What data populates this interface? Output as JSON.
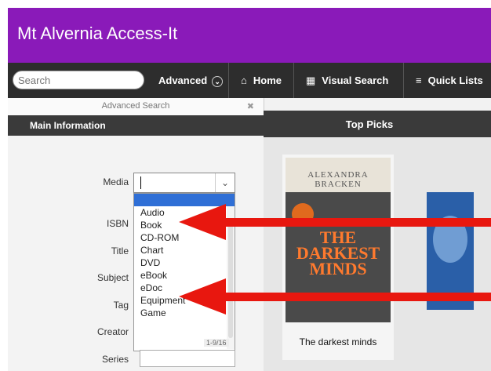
{
  "app": {
    "title": "Mt Alvernia Access-It"
  },
  "navbar": {
    "search_placeholder": "Search",
    "advanced_label": "Advanced",
    "home_label": "Home",
    "visual_search_label": "Visual Search",
    "quick_lists_label": "Quick Lists"
  },
  "advanced_search": {
    "panel_title": "Advanced Search",
    "close_glyph": "✖",
    "section_title": "Main Information",
    "labels": {
      "media": "Media",
      "isbn": "ISBN",
      "title": "Title",
      "subject": "Subject",
      "tag": "Tag",
      "creator": "Creator",
      "series": "Series"
    },
    "media_value": "",
    "media_options": [
      "Audio",
      "Book",
      "CD-ROM",
      "Chart",
      "DVD",
      "eBook",
      "eDoc",
      "Equipment",
      "Game"
    ],
    "page_count": "1-9/16"
  },
  "top_picks": {
    "title": "Top Picks",
    "cover_author": "ALEXANDRA BRACKEN",
    "cover_title_line1": "THE",
    "cover_title_line2": "DARKEST",
    "cover_title_line3": "MINDS",
    "book_title": "The darkest minds"
  },
  "colors": {
    "title_bar": "#8a1ab9",
    "nav_bar": "#2d2d2d",
    "section_bar": "#3a3a3a",
    "selected_option": "#2f6fd6",
    "arrow": "#e8170f"
  }
}
